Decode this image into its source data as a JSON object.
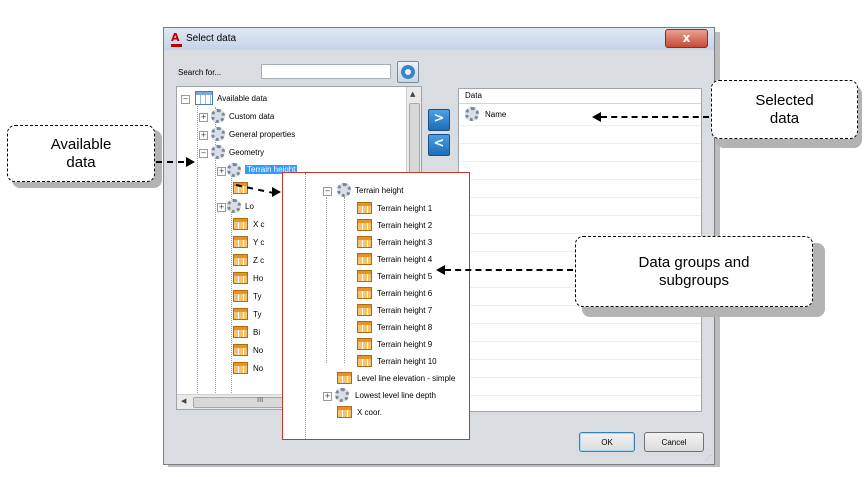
{
  "dialog": {
    "title": "Select data",
    "close_symbol": "x",
    "search_label": "Search for...",
    "search_value": "",
    "ok_label": "OK",
    "cancel_label": "Cancel",
    "move_right_symbol": ">",
    "move_left_symbol": "<"
  },
  "tree": {
    "root": "Available data",
    "items": [
      {
        "label": "Custom data",
        "icon": "gear-icon"
      },
      {
        "label": "General properties",
        "icon": "gear-icon"
      },
      {
        "label": "Geometry",
        "icon": "gear-icon"
      },
      {
        "label": "Terrain height",
        "icon": "gear-icon"
      },
      {
        "label": "Lo",
        "icon": "gear-icon"
      },
      {
        "label": "X c",
        "icon": "table-icon"
      },
      {
        "label": "Y c",
        "icon": "table-icon"
      },
      {
        "label": "Z c",
        "icon": "table-icon"
      },
      {
        "label": "Ho",
        "icon": "table-icon"
      },
      {
        "label": "Ty",
        "icon": "table-icon"
      },
      {
        "label": "Ty",
        "icon": "table-icon"
      },
      {
        "label": "Bi",
        "icon": "table-icon"
      },
      {
        "label": "No",
        "icon": "table-icon"
      },
      {
        "label": "No",
        "icon": "table-icon"
      }
    ],
    "hscroll_grip": "III"
  },
  "data_list": {
    "header": "Data",
    "rows": [
      "Name"
    ]
  },
  "zoom": {
    "group": "Terrain height",
    "children": [
      "Terrain height 1",
      "Terrain height 2",
      "Terrain height 3",
      "Terrain height 4",
      "Terrain height 5",
      "Terrain height 6",
      "Terrain height 7",
      "Terrain height 8",
      "Terrain height 9",
      "Terrain height 10"
    ],
    "after": [
      {
        "label": "Level line elevation - simple",
        "icon": "table-icon"
      },
      {
        "label": "Lowest level line depth",
        "icon": "gear-icon"
      },
      {
        "label": "X coor.",
        "icon": "table-icon"
      }
    ]
  },
  "callouts": {
    "available_line1": "Available",
    "available_line2": "data",
    "selected_line1": "Selected",
    "selected_line2": "data",
    "groups_line1": "Data groups and",
    "groups_line2": "subgroups"
  },
  "colors": {
    "selection": "#3399ff",
    "popup_border": "#c0392b",
    "close_button": "#c74a36"
  }
}
